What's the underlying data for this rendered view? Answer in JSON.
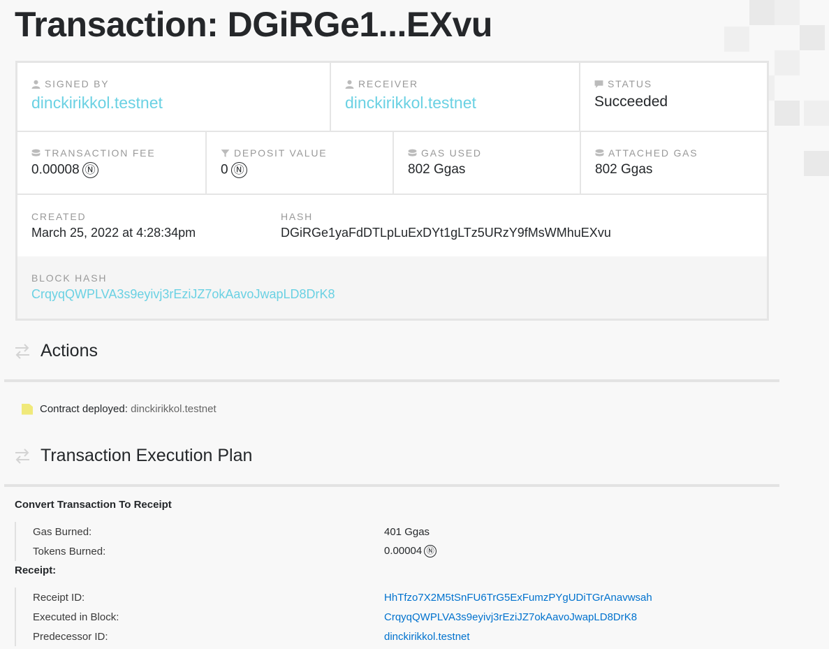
{
  "page": {
    "title": "Transaction: DGiRGe1...EXvu"
  },
  "summary": {
    "signed_by": {
      "label": "Signed by",
      "value": "dinckirikkol.testnet",
      "icon": "user-icon"
    },
    "receiver": {
      "label": "Receiver",
      "value": "dinckirikkol.testnet",
      "icon": "user-icon"
    },
    "status": {
      "label": "Status",
      "value": "Succeeded",
      "icon": "comment-icon"
    },
    "transaction_fee": {
      "label": "Transaction Fee",
      "value": "0.00008",
      "unit": "Ⓝ",
      "icon": "coins-icon"
    },
    "deposit_value": {
      "label": "Deposit Value",
      "value": "0",
      "unit": "Ⓝ",
      "icon": "filter-icon"
    },
    "gas_used": {
      "label": "Gas Used",
      "value": "802 Ggas",
      "icon": "coins-icon"
    },
    "attached_gas": {
      "label": "Attached Gas",
      "value": "802 Ggas",
      "icon": "coins-icon"
    },
    "created": {
      "label": "Created",
      "value": "March 25, 2022 at 4:28:34pm"
    },
    "hash": {
      "label": "Hash",
      "value": "DGiRGe1yaFdDTLpLuExDYt1gLTz5URzY9fMsWMhuEXvu"
    },
    "block_hash": {
      "label": "Block Hash",
      "value": "CrqyqQWPLVA3s9eyivj3rEziJZ7okAavoJwapLD8DrK8"
    }
  },
  "actions": {
    "heading": "Actions",
    "items": [
      {
        "label": "Contract deployed:",
        "value": "dinckirikkol.testnet"
      }
    ]
  },
  "plan": {
    "heading": "Transaction Execution Plan",
    "convert": {
      "title": "Convert Transaction To Receipt",
      "rows": [
        {
          "key": "Gas Burned:",
          "value": "401 Ggas"
        },
        {
          "key": "Tokens Burned:",
          "value": "0.00004"
        }
      ]
    },
    "receipt": {
      "title": "Receipt:",
      "rows": [
        {
          "key": "Receipt ID:",
          "value": "HhTfzo7X2M5tSnFU6TrG5ExFumzPYgUDiTGrAnavwsah"
        },
        {
          "key": "Executed in Block:",
          "value": "CrqyqQWPLVA3s9eyivj3rEziJZ7okAavoJwapLD8DrK8"
        },
        {
          "key": "Predecessor ID:",
          "value": "dinckirikkol.testnet"
        }
      ]
    }
  },
  "colors": {
    "link": "#6ad1e3",
    "plan_link": "#0072ce",
    "label": "#999999",
    "accent_doc": "#f0e97a"
  }
}
